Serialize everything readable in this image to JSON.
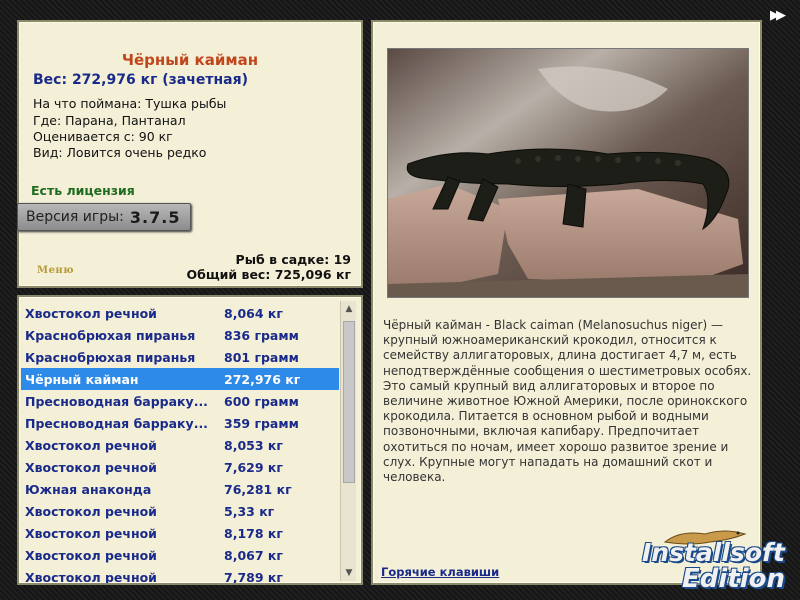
{
  "info": {
    "title": "Чёрный кайман",
    "weight": "Вес: 272,976 кг (зачетная)",
    "caught_on": "На что поймана: Тушка рыбы",
    "location": "Где: Парана, Пантанал",
    "valued_from": "Оценивается с: 90 кг",
    "species_note": "Вид: Ловится очень редко",
    "license": "Есть лицензия",
    "version_label": "Версия игры:",
    "version_number": "3.7.5",
    "menu_label": "Меню",
    "fish_in_keepnet": "Рыб в садке: 19",
    "total_weight": "Общий вес: 725,096 кг"
  },
  "catch_list": [
    {
      "name": "Хвостокол речной",
      "weight": "8,064 кг"
    },
    {
      "name": "Краснобрюхая пиранья",
      "weight": "836 грамм"
    },
    {
      "name": "Краснобрюхая пиранья",
      "weight": "801 грамм"
    },
    {
      "name": "Чёрный кайман",
      "weight": "272,976 кг"
    },
    {
      "name": "Пресноводная барраку...",
      "weight": "600 грамм"
    },
    {
      "name": "Пресноводная барраку...",
      "weight": "359 грамм"
    },
    {
      "name": "Хвостокол речной",
      "weight": "8,053 кг"
    },
    {
      "name": "Хвостокол речной",
      "weight": "7,629 кг"
    },
    {
      "name": "Южная анаконда",
      "weight": "76,281 кг"
    },
    {
      "name": "Хвостокол речной",
      "weight": "5,33 кг"
    },
    {
      "name": "Хвостокол речной",
      "weight": "8,178 кг"
    },
    {
      "name": "Хвостокол речной",
      "weight": "8,067 кг"
    },
    {
      "name": "Хвостокол речной",
      "weight": "7,789 кг"
    }
  ],
  "selected_index": 3,
  "detail": {
    "description": "Чёрный кайман - Black caiman (Melanosuchus niger) — крупный южноамериканский крокодил, относится к семейству аллигаторовых, длина достигает 4,7 м, есть неподтверждённые сообщения о шестиметровых особях. Это самый крупный вид аллигаторовых и второе по величине животное Южной Америки, после оринокского крокодила. Питается в основном рыбой и водными позвоночными, включая капибару. Предпочитает охотиться по ночам, имеет хорошо развитое зрение и слух. Крупные могут нападать на домашний скот и человека.",
    "hotkeys_link": "Горячие клавиши"
  },
  "watermark": {
    "line1": "Installsoft",
    "line2": "Edition"
  },
  "colors": {
    "panel_bg": "#f4f0d8",
    "title_orange": "#c0461c",
    "text_blue": "#1a2a8a",
    "license_green": "#1f6b1f",
    "selection_blue": "#2e8ae8"
  }
}
